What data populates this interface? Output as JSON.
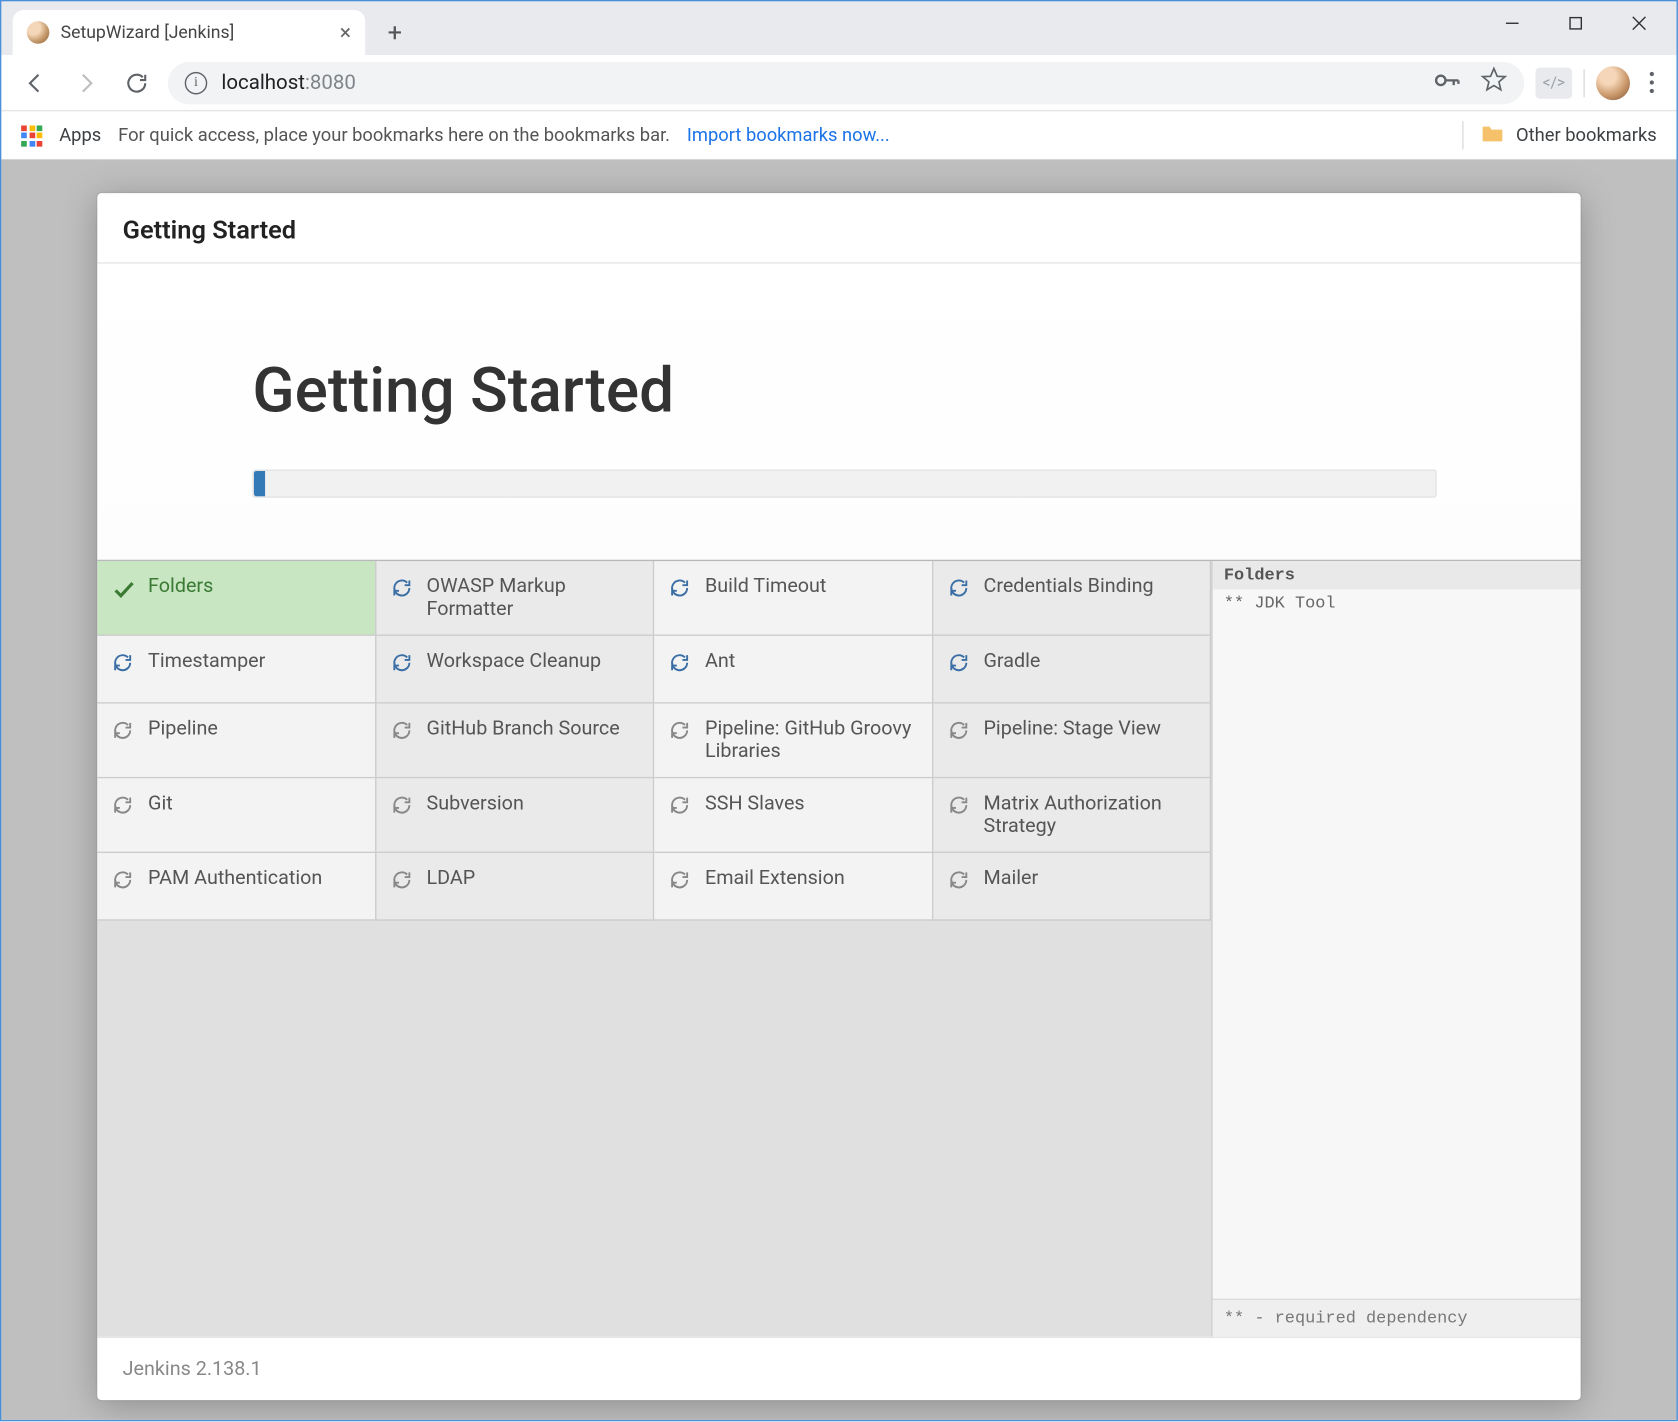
{
  "browser": {
    "tab_title": "SetupWizard [Jenkins]",
    "url_host": "localhost",
    "url_port": ":8080",
    "bookmarks": {
      "apps_label": "Apps",
      "hint": "For quick access, place your bookmarks here on the bookmarks bar.",
      "import_link": "Import bookmarks now...",
      "other_label": "Other bookmarks"
    }
  },
  "wizard": {
    "header": "Getting Started",
    "title": "Getting Started",
    "progress_percent": 1,
    "footer_version": "Jenkins 2.138.1"
  },
  "plugins": [
    {
      "name": "Folders",
      "status": "done"
    },
    {
      "name": "OWASP Markup Formatter",
      "status": "pending"
    },
    {
      "name": "Build Timeout",
      "status": "pending"
    },
    {
      "name": "Credentials Binding",
      "status": "pending"
    },
    {
      "name": "Timestamper",
      "status": "pending"
    },
    {
      "name": "Workspace Cleanup",
      "status": "pending"
    },
    {
      "name": "Ant",
      "status": "pending"
    },
    {
      "name": "Gradle",
      "status": "pending"
    },
    {
      "name": "Pipeline",
      "status": "pending"
    },
    {
      "name": "GitHub Branch Source",
      "status": "pending"
    },
    {
      "name": "Pipeline: GitHub Groovy Libraries",
      "status": "pending"
    },
    {
      "name": "Pipeline: Stage View",
      "status": "pending"
    },
    {
      "name": "Git",
      "status": "pending"
    },
    {
      "name": "Subversion",
      "status": "pending"
    },
    {
      "name": "SSH Slaves",
      "status": "pending"
    },
    {
      "name": "Matrix Authorization Strategy",
      "status": "pending"
    },
    {
      "name": "PAM Authentication",
      "status": "pending"
    },
    {
      "name": "LDAP",
      "status": "pending"
    },
    {
      "name": "Email Extension",
      "status": "pending"
    },
    {
      "name": "Mailer",
      "status": "pending"
    }
  ],
  "log": {
    "lines": [
      {
        "text": "Folders",
        "hl": true
      },
      {
        "text": "** JDK Tool",
        "hl": false
      }
    ],
    "footer": "** - required dependency"
  }
}
